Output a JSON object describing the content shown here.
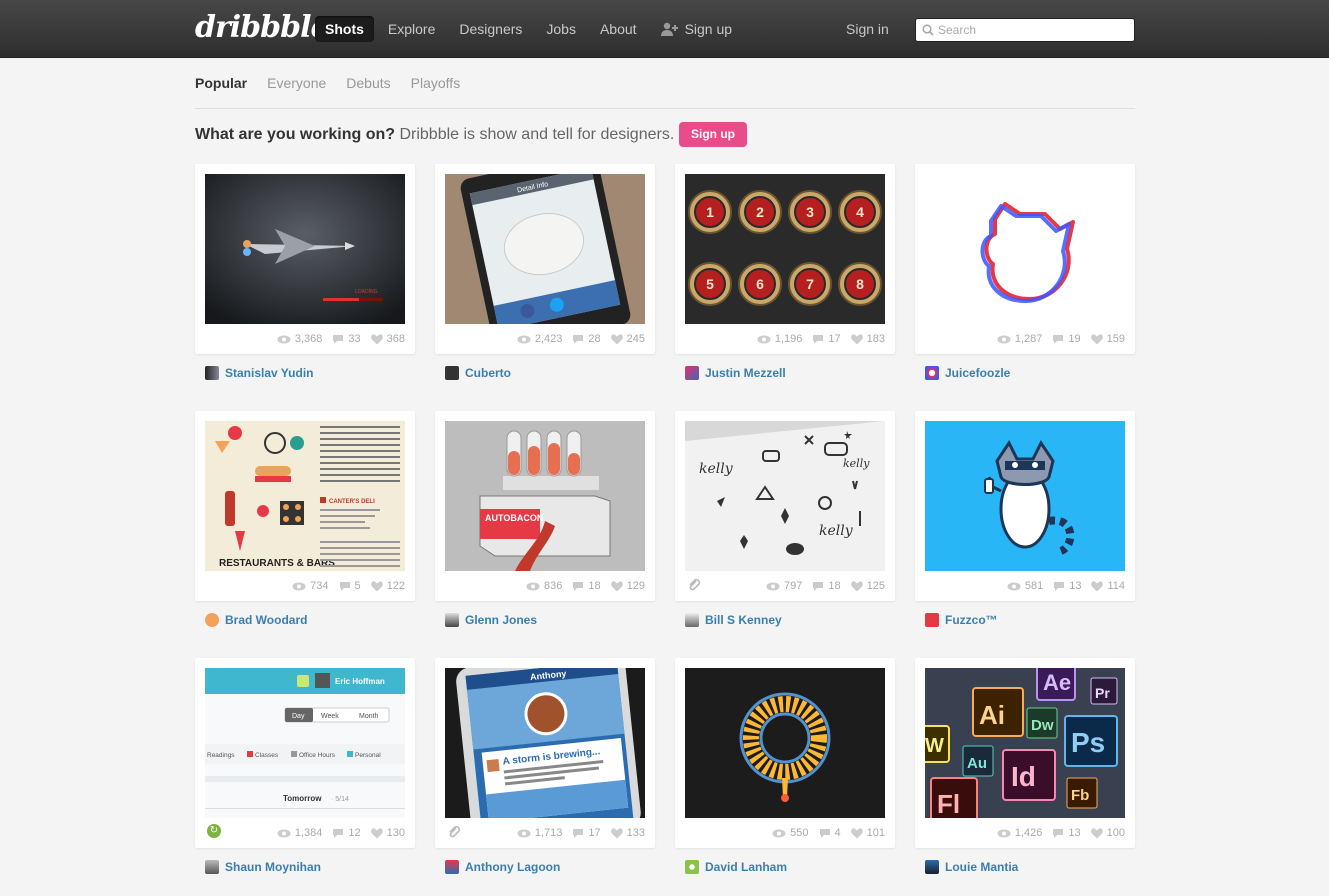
{
  "header": {
    "logo": "dribbble",
    "nav": [
      "Shots",
      "Explore",
      "Designers",
      "Jobs",
      "About",
      "Sign up"
    ],
    "signin": "Sign in",
    "search_placeholder": "Search"
  },
  "subnav": [
    "Popular",
    "Everyone",
    "Debuts",
    "Playoffs"
  ],
  "tagline": {
    "bold": "What are you working on?",
    "rest": "Dribbble is show and tell for designers.",
    "button": "Sign up"
  },
  "colors": {
    "accent": "#ea4c89",
    "link": "#3a7fb0",
    "header": "#333333"
  },
  "shots": [
    {
      "views": "3,368",
      "comments": "33",
      "likes": "368",
      "player": "Stanislav Yudin"
    },
    {
      "views": "2,423",
      "comments": "28",
      "likes": "245",
      "player": "Cuberto"
    },
    {
      "views": "1,196",
      "comments": "17",
      "likes": "183",
      "player": "Justin Mezzell"
    },
    {
      "views": "1,287",
      "comments": "19",
      "likes": "159",
      "player": "Juicefoozle"
    },
    {
      "views": "734",
      "comments": "5",
      "likes": "122",
      "player": "Brad Woodard"
    },
    {
      "views": "836",
      "comments": "18",
      "likes": "129",
      "player": "Glenn Jones"
    },
    {
      "views": "797",
      "comments": "18",
      "likes": "125",
      "player": "Bill S Kenney"
    },
    {
      "views": "581",
      "comments": "13",
      "likes": "114",
      "player": "Fuzzco™"
    },
    {
      "views": "1,384",
      "comments": "12",
      "likes": "130",
      "player": "Shaun Moynihan"
    },
    {
      "views": "1,713",
      "comments": "17",
      "likes": "133",
      "player": "Anthony Lagoon"
    },
    {
      "views": "550",
      "comments": "4",
      "likes": "101",
      "player": "David Lanham"
    },
    {
      "views": "1,426",
      "comments": "13",
      "likes": "100",
      "player": "Louie Mantia"
    }
  ],
  "thumb_text": {
    "s1": "LOADING",
    "s2": "Detail Info",
    "s3": [
      "1",
      "2",
      "3",
      "4",
      "5",
      "6",
      "7",
      "8"
    ],
    "s5a": "CANTER'S DELI",
    "s5b": "RESTAURANTS & BARS",
    "s6": "AUTOBACON",
    "s7": [
      "kelly",
      "kelly",
      "kelly"
    ],
    "s9a": "Eric Hoffman",
    "s9tabs": [
      "Day",
      "Week",
      "Month"
    ],
    "s9filters": [
      "Readings",
      "Classes",
      "Office Hours",
      "Personal"
    ],
    "s9date": "Tomorrow",
    "s9datenum": "· 5/14",
    "s10a": "Anthony",
    "s10b": "A storm is brewing...",
    "s12": [
      "Ae",
      "Pr",
      "Ai",
      "Dw",
      "Ps",
      "Au",
      "Id",
      "Fl",
      "Fb",
      "W"
    ]
  }
}
